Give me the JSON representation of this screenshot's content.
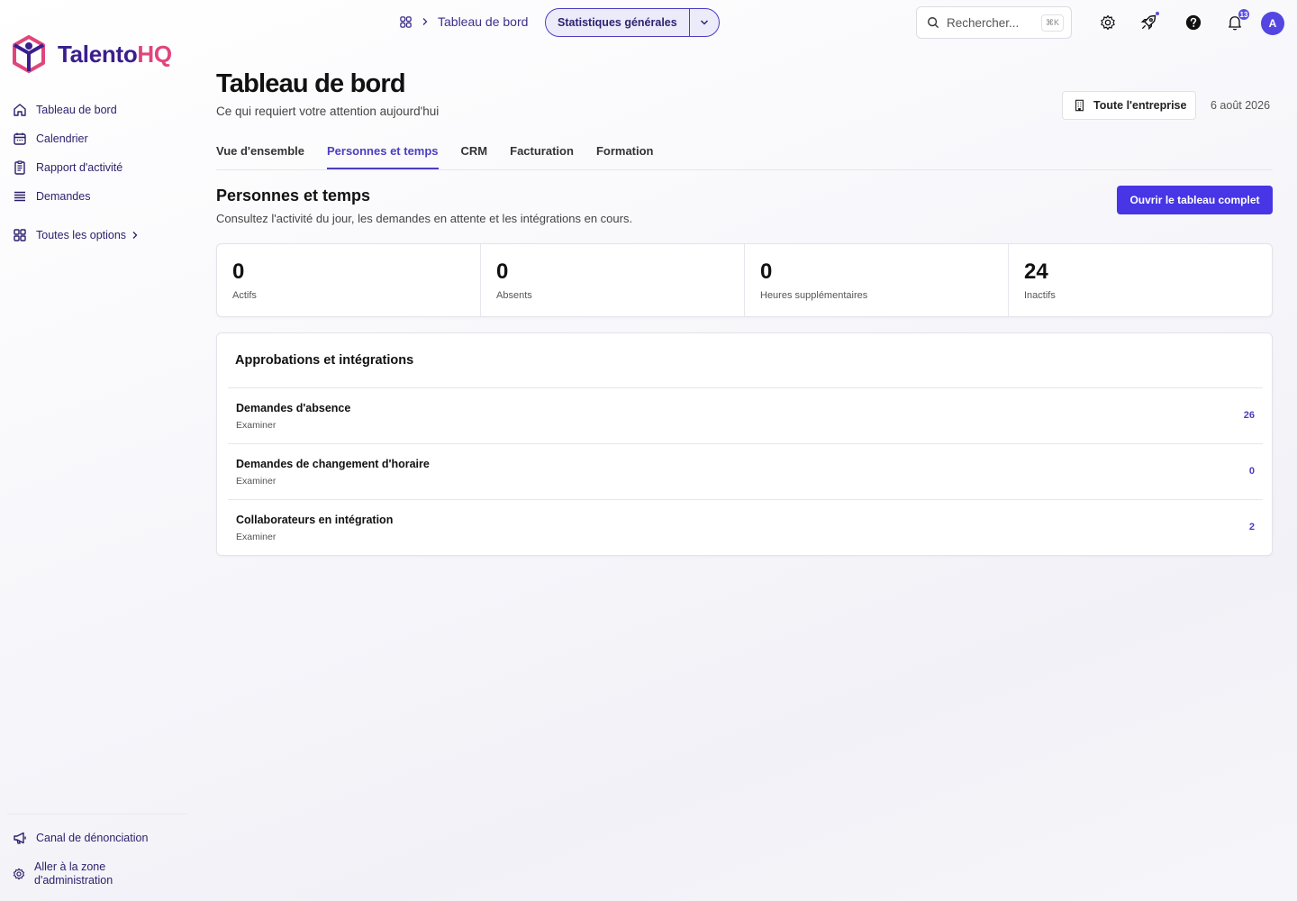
{
  "brand": {
    "name_part1": "Talento",
    "name_part2": "HQ",
    "color_primary": "#3a1f8c",
    "color_secondary": "#e0457b"
  },
  "sidebar": {
    "items": [
      {
        "label": "Tableau de bord",
        "icon": "home-icon"
      },
      {
        "label": "Calendrier",
        "icon": "calendar-icon"
      },
      {
        "label": "Rapport d'activité",
        "icon": "report-icon"
      },
      {
        "label": "Demandes",
        "icon": "list-icon"
      }
    ],
    "all_options": {
      "label": "Toutes les options",
      "icon": "grid-icon"
    },
    "bottom": [
      {
        "label": "Canal de dénonciation",
        "icon": "megaphone-icon"
      },
      {
        "label": "Aller à la zone d'administration",
        "icon": "gear-icon"
      }
    ]
  },
  "topbar": {
    "breadcrumb": "Tableau de bord",
    "view_select": "Statistiques générales",
    "search_placeholder": "Rechercher...",
    "search_shortcut": "⌘K",
    "notification_count": "13",
    "avatar_initial": "A",
    "accent": "#4735e6"
  },
  "header": {
    "title": "Tableau de bord",
    "subtitle": "Ce qui requiert votre attention aujourd'hui",
    "scope_label": "Toute l'entreprise",
    "date": "6 août 2026"
  },
  "tabs": [
    {
      "label": "Vue d'ensemble",
      "active": false
    },
    {
      "label": "Personnes et temps",
      "active": true
    },
    {
      "label": "CRM",
      "active": false
    },
    {
      "label": "Facturation",
      "active": false
    },
    {
      "label": "Formation",
      "active": false
    }
  ],
  "section": {
    "title": "Personnes et temps",
    "subtitle": "Consultez l'activité du jour, les demandes en attente et les intégrations en cours.",
    "cta": "Ouvrir le tableau complet"
  },
  "stats": [
    {
      "value": "0",
      "label": "Actifs"
    },
    {
      "value": "0",
      "label": "Absents"
    },
    {
      "value": "0",
      "label": "Heures supplémentaires"
    },
    {
      "value": "24",
      "label": "Inactifs"
    }
  ],
  "approvals": {
    "title": "Approbations et intégrations",
    "rows": [
      {
        "title": "Demandes d'absence",
        "action": "Examiner",
        "count": "26"
      },
      {
        "title": "Demandes de changement d'horaire",
        "action": "Examiner",
        "count": "0"
      },
      {
        "title": "Collaborateurs en intégration",
        "action": "Examiner",
        "count": "2"
      }
    ]
  }
}
